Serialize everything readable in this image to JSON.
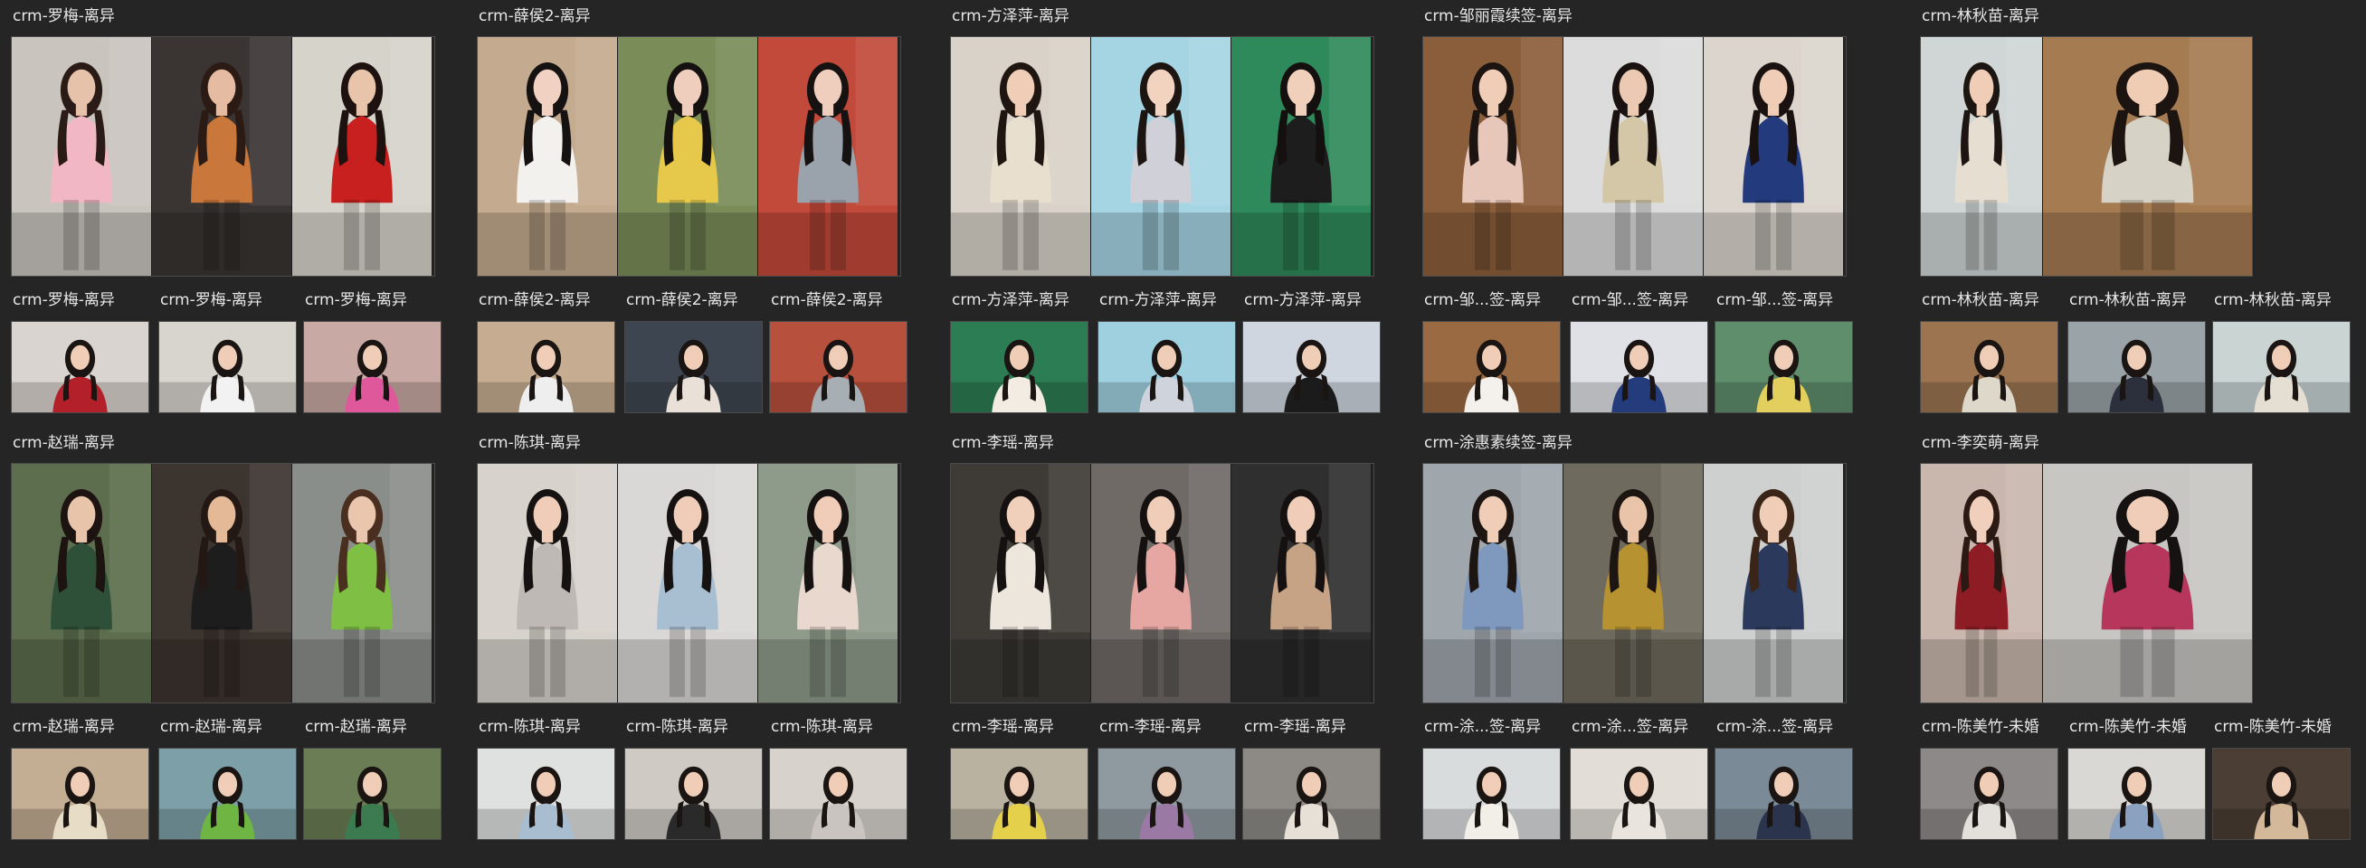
{
  "colors": {
    "background": "#252525",
    "thumb_border": "#4a4a4a",
    "label_text": "#e8e8e8"
  },
  "groups": [
    {
      "collage_label": "crm-罗梅-离异",
      "collage_panels": [
        {
          "bg": "#c9c4be",
          "accent": "#f1b7c4",
          "hair": "#2a1b16",
          "skin": "#e7c2ab"
        },
        {
          "bg": "#3a3533",
          "accent": "#c9773a",
          "hair": "#2b1b14",
          "skin": "#e5bca2"
        },
        {
          "bg": "#d6d3cb",
          "accent": "#c8201f",
          "hair": "#1d1210",
          "skin": "#e8c4ab"
        }
      ],
      "sub_items": [
        {
          "label": "crm-罗梅-离异",
          "bg": "#d9d4cf",
          "accent": "#b3202a"
        },
        {
          "label": "crm-罗梅-离异",
          "bg": "#d8d5cf",
          "accent": "#f2f2f2"
        },
        {
          "label": "crm-罗梅-离异",
          "bg": "#c8a9a3",
          "accent": "#e0589c"
        }
      ]
    },
    {
      "collage_label": "crm-薛侯2-离异",
      "collage_panels": [
        {
          "bg": "#c4ab8f",
          "accent": "#f3f1ee",
          "hair": "#161212",
          "skin": "#f1d2c2"
        },
        {
          "bg": "#7a8d58",
          "accent": "#e6c84a",
          "hair": "#151111",
          "skin": "#efcebd"
        },
        {
          "bg": "#c24a3a",
          "accent": "#9aa3ac",
          "hair": "#161212",
          "skin": "#efcebd"
        }
      ],
      "sub_items": [
        {
          "label": "crm-薛侯2-离异",
          "bg": "#c6ad91",
          "accent": "#efeeee"
        },
        {
          "label": "crm-薛侯2-离异",
          "bg": "#3d4650",
          "accent": "#e9e1d8"
        },
        {
          "label": "crm-薛侯2-离异",
          "bg": "#b8503e",
          "accent": "#a7aeb4"
        }
      ]
    },
    {
      "collage_label": "crm-方泽萍-离异",
      "collage_panels": [
        {
          "bg": "#d8d2c8",
          "accent": "#e9dfcf",
          "hair": "#1f1612",
          "skin": "#efcdb6"
        },
        {
          "bg": "#a5d5e3",
          "accent": "#cfd0d8",
          "hair": "#1d1512",
          "skin": "#f2d3c0"
        },
        {
          "bg": "#2f8a5b",
          "accent": "#1d1d1d",
          "hair": "#141010",
          "skin": "#f0cfbb"
        }
      ],
      "sub_items": [
        {
          "label": "crm-方泽萍-离异",
          "bg": "#2c7d53",
          "accent": "#f2ece2"
        },
        {
          "label": "crm-方泽萍-离异",
          "bg": "#9fd0e0",
          "accent": "#cfd3dc"
        },
        {
          "label": "crm-方泽萍-离异",
          "bg": "#cfd6df",
          "accent": "#1b1b1b"
        }
      ]
    },
    {
      "collage_label": "crm-邹丽霞续签-离异",
      "collage_panels": [
        {
          "bg": "#8b5e3b",
          "accent": "#e8c7bb",
          "hair": "#1c1411",
          "skin": "#efcdb7"
        },
        {
          "bg": "#dcdcdc",
          "accent": "#d3c7a7",
          "hair": "#1a1210",
          "skin": "#ecc9b3"
        },
        {
          "bg": "#dbd5cd",
          "accent": "#233a7c",
          "hair": "#1a1210",
          "skin": "#efcdb7"
        }
      ],
      "sub_items": [
        {
          "label": "crm-邹...签-离异",
          "bg": "#9a6a43",
          "accent": "#f4f1ec"
        },
        {
          "label": "crm-邹...签-离异",
          "bg": "#dfe1e6",
          "accent": "#253c7c"
        },
        {
          "label": "crm-邹...签-离异",
          "bg": "#5e8e6c",
          "accent": "#e3cf5d"
        }
      ]
    },
    {
      "collage_label": "crm-林秋苗-离异",
      "collage_panels": [
        {
          "bg": "#cfd6d5",
          "accent": "#e6ded1",
          "hair": "#1d1512",
          "skin": "#efcdb6"
        },
        {
          "bg": "#a57b52",
          "accent": "#d6d2c6",
          "hair": "#1c1411",
          "skin": "#efccb4"
        }
      ],
      "sub_items": [
        {
          "label": "crm-林秋苗-离异",
          "bg": "#9c7550",
          "accent": "#ded8ca"
        },
        {
          "label": "crm-林秋苗-离异",
          "bg": "#9aa3a8",
          "accent": "#2c2f3c"
        },
        {
          "label": "crm-林秋苗-离异",
          "bg": "#c9d4d3",
          "accent": "#e5ded2"
        }
      ]
    },
    {
      "collage_label": "crm-赵瑞-离异",
      "collage_panels": [
        {
          "bg": "#5c6e4d",
          "accent": "#2e4f38",
          "hair": "#1d1411",
          "skin": "#e8c4aa"
        },
        {
          "bg": "#3c342f",
          "accent": "#1d1d1d",
          "hair": "#231813",
          "skin": "#e3b997"
        },
        {
          "bg": "#8a8e8a",
          "accent": "#7fbf43",
          "hair": "#4a2f20",
          "skin": "#e9c6ad"
        }
      ],
      "sub_items": [
        {
          "label": "crm-赵瑞-离异",
          "bg": "#c3ad93",
          "accent": "#e7dcc6"
        },
        {
          "label": "crm-赵瑞-离异",
          "bg": "#7da0a8",
          "accent": "#6fb544"
        },
        {
          "label": "crm-赵瑞-离异",
          "bg": "#6a7d55",
          "accent": "#3b7b4f"
        }
      ]
    },
    {
      "collage_label": "crm-陈琪-离异",
      "collage_panels": [
        {
          "bg": "#d7d2cc",
          "accent": "#bfb9b6",
          "hair": "#171212",
          "skin": "#efcdb9"
        },
        {
          "bg": "#d9d8d6",
          "accent": "#a8bed1",
          "hair": "#171212",
          "skin": "#efcdb9"
        },
        {
          "bg": "#8e9a8a",
          "accent": "#e9d8ce",
          "hair": "#171212",
          "skin": "#efcdb9"
        }
      ],
      "sub_items": [
        {
          "label": "crm-陈琪-离异",
          "bg": "#dfe0e0",
          "accent": "#a8bdd0"
        },
        {
          "label": "crm-陈琪-离异",
          "bg": "#cfcac4",
          "accent": "#2a2a2a"
        },
        {
          "label": "crm-陈琪-离异",
          "bg": "#d7d2cc",
          "accent": "#c9c4c0"
        }
      ]
    },
    {
      "collage_label": "crm-李瑶-离异",
      "collage_panels": [
        {
          "bg": "#3e3b37",
          "accent": "#ece6dd",
          "hair": "#151111",
          "skin": "#f0cfbb"
        },
        {
          "bg": "#6f6a66",
          "accent": "#e6a7a2",
          "hair": "#151111",
          "skin": "#efcdb8"
        },
        {
          "bg": "#2f2f30",
          "accent": "#c7a386",
          "hair": "#151111",
          "skin": "#efcdb8"
        }
      ],
      "sub_items": [
        {
          "label": "crm-李瑶-离异",
          "bg": "#b9b2a0",
          "accent": "#e4d04a"
        },
        {
          "label": "crm-李瑶-离异",
          "bg": "#8e9aa0",
          "accent": "#9a7aa5"
        },
        {
          "label": "crm-李瑶-离异",
          "bg": "#8d8a86",
          "accent": "#e6e0d6"
        }
      ]
    },
    {
      "collage_label": "crm-涂惠素续签-离异",
      "collage_panels": [
        {
          "bg": "#9fa7ac",
          "accent": "#7f98bd",
          "hair": "#1d1512",
          "skin": "#efcdb6"
        },
        {
          "bg": "#6e6a5d",
          "accent": "#b79231",
          "hair": "#1d1512",
          "skin": "#e9c4a9"
        },
        {
          "bg": "#cdd0cf",
          "accent": "#2b3a5c",
          "hair": "#3a2518",
          "skin": "#efcdb6"
        }
      ],
      "sub_items": [
        {
          "label": "crm-涂...签-离异",
          "bg": "#d9dcdd",
          "accent": "#f1efe8"
        },
        {
          "label": "crm-涂...签-离异",
          "bg": "#e2ddd7",
          "accent": "#e9e4dd"
        },
        {
          "label": "crm-涂...签-离异",
          "bg": "#7a8a96",
          "accent": "#2b344d"
        }
      ]
    },
    {
      "collage_label": "crm-李奕萌-离异",
      "collage_panels": [
        {
          "bg": "#c9b7ad",
          "accent": "#8d1c24",
          "hair": "#2a1a13",
          "skin": "#f0d0bc"
        },
        {
          "bg": "#c8c6c3",
          "accent": "#b7365c",
          "hair": "#171212",
          "skin": "#efcdb8"
        }
      ],
      "sub_items": [
        {
          "label": "crm-陈美竹-未婚",
          "bg": "#8e8989",
          "accent": "#e3e0dc"
        },
        {
          "label": "crm-陈美竹-未婚",
          "bg": "#d9d8d5",
          "accent": "#8aa2c0"
        },
        {
          "label": "crm-陈美竹-未婚",
          "bg": "#4b3e34",
          "accent": "#d4b89a"
        }
      ]
    }
  ]
}
